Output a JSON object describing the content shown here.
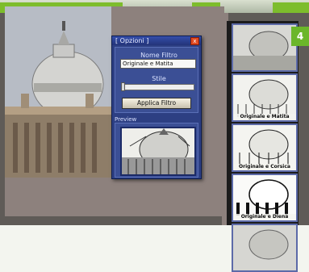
{
  "dialog": {
    "title": "[ Opzioni ]",
    "close_label": "x",
    "filter_name_label": "Nome Filtro",
    "filter_name_value": "Originale e Matita",
    "style_label": "Stile",
    "apply_button": "Applica Filtro",
    "preview_label": "Preview"
  },
  "thumbnails": [
    {
      "label": ""
    },
    {
      "label": "Originale e Matita"
    },
    {
      "label": "Originale e Corsica"
    },
    {
      "label": "Originale e Diena"
    },
    {
      "label": ""
    }
  ],
  "badge": {
    "step": "4"
  },
  "colors": {
    "dialog_bg": "#2d3f83",
    "accent_green": "#6bb62a",
    "close_red": "#e04a22"
  }
}
